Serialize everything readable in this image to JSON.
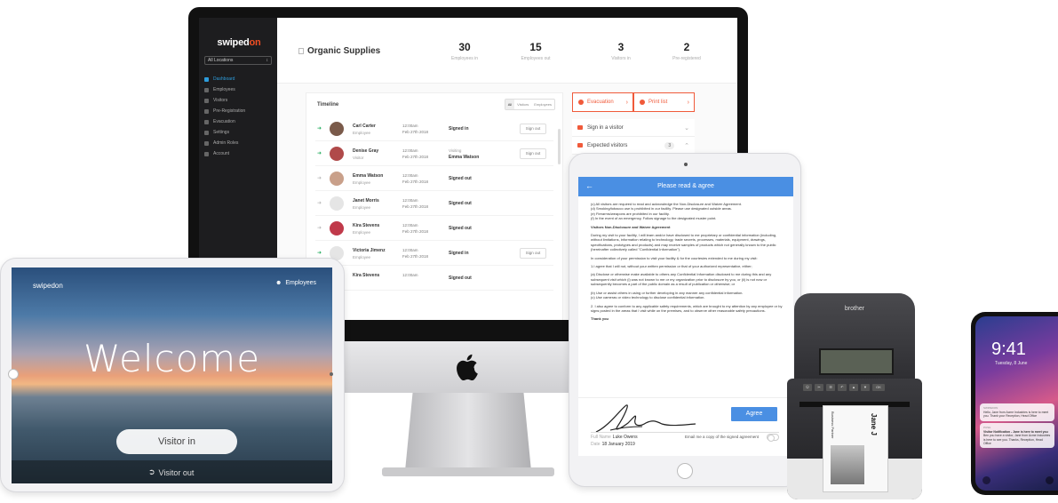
{
  "dashboard": {
    "brand_main": "swiped",
    "brand_accent": "on",
    "location_select": "All Locations",
    "nav": [
      {
        "label": "Dashboard",
        "active": true
      },
      {
        "label": "Employees"
      },
      {
        "label": "Visitors"
      },
      {
        "label": "Pre-Registration"
      },
      {
        "label": "Evacuation"
      },
      {
        "label": "Settings"
      },
      {
        "label": "Admin Roles"
      },
      {
        "label": "Account"
      }
    ],
    "page_title": "Organic Supplies",
    "stats": [
      {
        "value": "30",
        "label": "Employees in"
      },
      {
        "value": "15",
        "label": "Employees out"
      },
      {
        "value": "3",
        "label": "Visitors in"
      },
      {
        "value": "2",
        "label": "Pre-registered"
      }
    ],
    "timeline": {
      "title": "Timeline",
      "tabs": [
        "All",
        "Visitors",
        "Employees"
      ],
      "rows": [
        {
          "name": "Carl Carter",
          "role": "Employee",
          "time": "12:00am",
          "date": "Feb 27th 2018",
          "status": "Signed in",
          "action": "Sign out",
          "dir": "in",
          "avatar": "#7a5a4a"
        },
        {
          "name": "Denise Gray",
          "role": "Visitor",
          "time": "12:00am",
          "date": "Feb 27th 2018",
          "status_sub": "Visiting",
          "status": "Emma Watson",
          "action": "Sign out",
          "dir": "in",
          "avatar": "#b04a4a"
        },
        {
          "name": "Emma Watson",
          "role": "Employee",
          "time": "12:00am",
          "date": "Feb 27th 2018",
          "status": "Signed out",
          "dir": "out",
          "avatar": "#c9a08a"
        },
        {
          "name": "Janet Morris",
          "role": "Employee",
          "time": "12:00am",
          "date": "Feb 27th 2018",
          "status": "Signed out",
          "dir": "out",
          "avatar": "#e5e5e5"
        },
        {
          "name": "Kira Stevens",
          "role": "Employee",
          "time": "12:00am",
          "date": "Feb 27th 2018",
          "status": "Signed out",
          "dir": "out",
          "avatar": "#c0394a"
        },
        {
          "name": "Victoria Jimenz",
          "role": "Employee",
          "time": "12:00am",
          "date": "Feb 27th 2018",
          "status": "Signed in",
          "action": "Sign out",
          "dir": "in",
          "avatar": "#e5e5e5"
        },
        {
          "name": "Kira Stevens",
          "role": "",
          "time": "12:00am",
          "date": "",
          "status": "Signed out",
          "dir": "out",
          "avatar": "#c0394a"
        }
      ]
    },
    "actions": {
      "evacuation": "Evacuation",
      "print_list": "Print list"
    },
    "side_list": [
      {
        "label": "Sign in a visitor"
      },
      {
        "label": "Expected visitors",
        "badge": "3"
      }
    ]
  },
  "ipad_welcome": {
    "brand": "swipedon",
    "employees": "Employees",
    "welcome": "Welcome",
    "visitor_in": "Visitor in",
    "visitor_out": "Visitor out"
  },
  "ipad_agreement": {
    "title": "Please read & agree",
    "lines_top": [
      "(c) All visitors are required to read and acknowledge the Non-Disclosure and Waiver Agreement.",
      "(d) Smoking/tobacco use is prohibited in our facility. Please use designated outside areas.",
      "(e) Firearms/weapons are prohibited in our facility.",
      "(f) In the event of an emergency, Follow signage to the designated muster point."
    ],
    "section_title": "Visitors Non-Disclosure and Waiver Agreement",
    "para1": "During my visit to your facility, I will learn and/or have disclosed to me proprietary or confidential information (including, without limitations, information relating to technology, trade secrets, processes, materials, equipment, drawings, specifications, prototypes and products) and may receive samples of products which not generally known to the public (hereinafter collectively called \"Confidential Information\").",
    "para2": "In consideration of your permission to visit your facility & for the courtesies extended to me during my visit:",
    "para3": "1.I agree that I will not, without your written permission or that of your authorized representative, either;",
    "para4": "(a) Disclose or otherwise make available to others any Confidential Information disclosed to me during this and any subsequent visit which (i) was not known to me or my organization prior to disclosure by you, or (ii) is not now or subsequently becomes a part of the public domain as a result of publication or otherwise; or",
    "para5": "(b) Use or assist others in using or further developing in any manner any confidential information.",
    "para6": "(c) Use cameras or video technology to disclose confidential information.",
    "para7": "2. I also agree to conform to any applicable safety requirements, which are brought to my attention by any employee or by signs posted in the areas that I visit while on the premises, and to observe other reasonable safety precautions.",
    "thanks": "Thank you",
    "agree_button": "Agree",
    "full_name_label": "Full Name",
    "full_name": "Luke Owens",
    "date_label": "Date",
    "date": "18 January 2019",
    "email_copy": "Email me a copy of the signed agreement"
  },
  "printer": {
    "brand": "brother",
    "label_name": "Jane J",
    "label_partner": "Business Partner",
    "keys": [
      "⏻",
      "✂",
      "☰",
      "↶",
      "▲",
      "▼",
      "OK"
    ]
  },
  "iphone": {
    "time": "9:41",
    "date": "Tuesday, 8 June",
    "notifications": [
      {
        "app": "SWIPEDON",
        "title": "",
        "body": "Hello, Jane from Acme Industries is here to meet you. Thank your Reception, Head Office"
      },
      {
        "app": "PUSH",
        "title": "Visitor Notification - Jane is here to meet you",
        "body": "Ben you have a visitor, Jane from Acme Industries is here to see you. Thanks, Reception, Head Office"
      }
    ]
  },
  "colors": {
    "accent": "#f04e23",
    "blue": "#4a8fe3",
    "green": "#27ae60",
    "sidebar": "#1d1d1f"
  }
}
